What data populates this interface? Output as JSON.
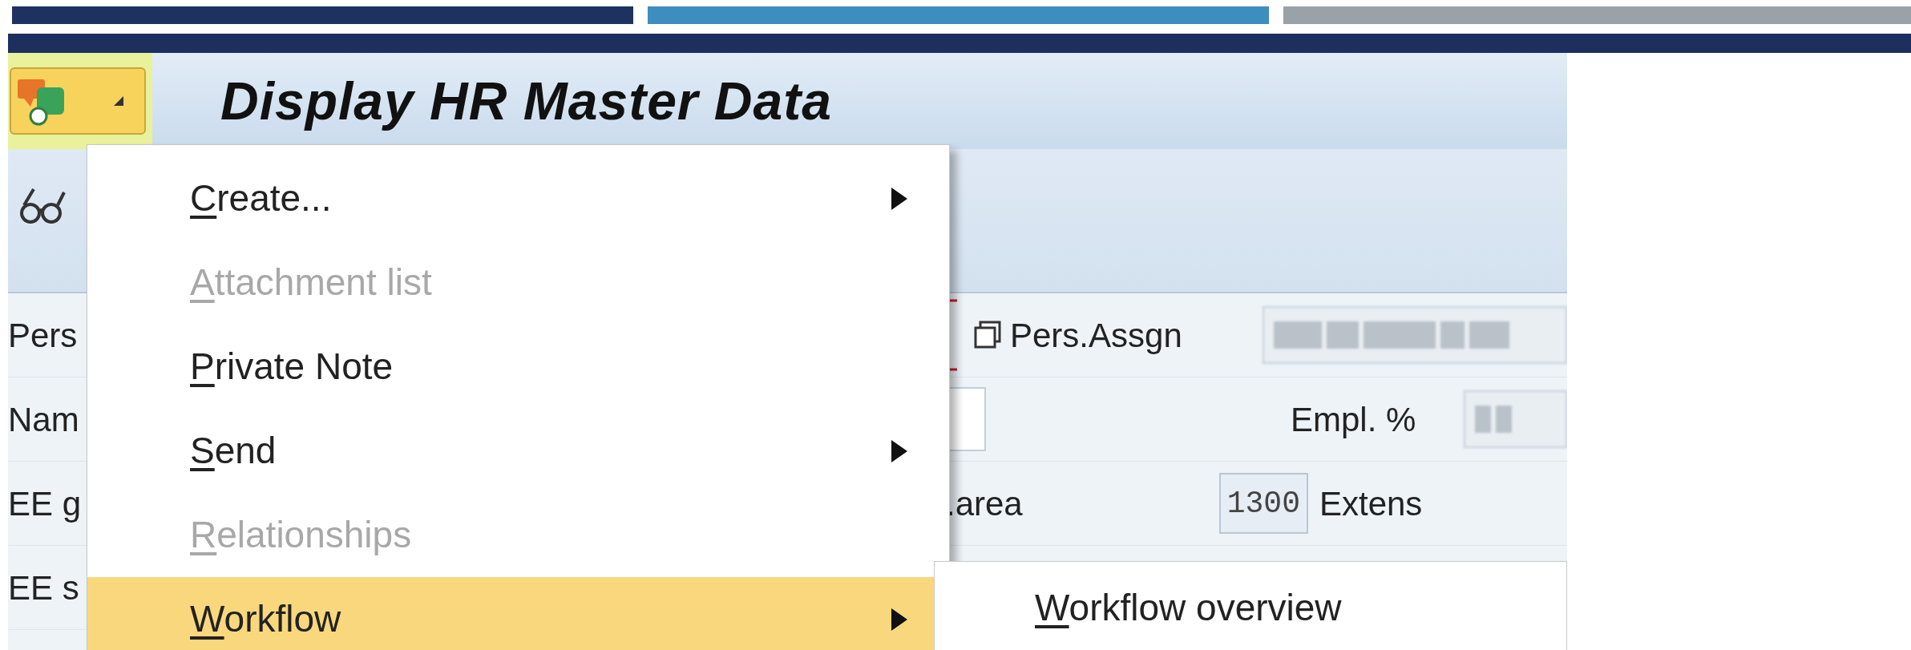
{
  "window": {
    "title": "Display HR Master Data"
  },
  "form_rows": [
    {
      "label": "Pers"
    },
    {
      "label": "Nam"
    },
    {
      "label": "EE g"
    },
    {
      "label": "EE s"
    }
  ],
  "fields": {
    "assignment_label": "Pers.Assgn",
    "employment_label": "Empl. %",
    "area_label": ".area",
    "area_value": "1300",
    "extension_label": "Extens"
  },
  "menu": {
    "items": [
      {
        "key": "C",
        "rest": "reate...",
        "disabled": false,
        "submenu": true,
        "selected": false
      },
      {
        "key": "A",
        "rest": "ttachment list",
        "disabled": true,
        "submenu": false,
        "selected": false
      },
      {
        "key": "P",
        "rest": "rivate Note",
        "disabled": false,
        "submenu": false,
        "selected": false
      },
      {
        "key": "S",
        "rest": "end",
        "disabled": false,
        "submenu": true,
        "selected": false
      },
      {
        "key": "R",
        "rest": "elationships",
        "disabled": true,
        "submenu": false,
        "selected": false
      },
      {
        "key": "W",
        "rest": "orkflow",
        "disabled": false,
        "submenu": true,
        "selected": true
      }
    ]
  },
  "submenu": {
    "items": [
      {
        "key": "W",
        "rest": "orkflow overview",
        "selected": false
      }
    ]
  }
}
